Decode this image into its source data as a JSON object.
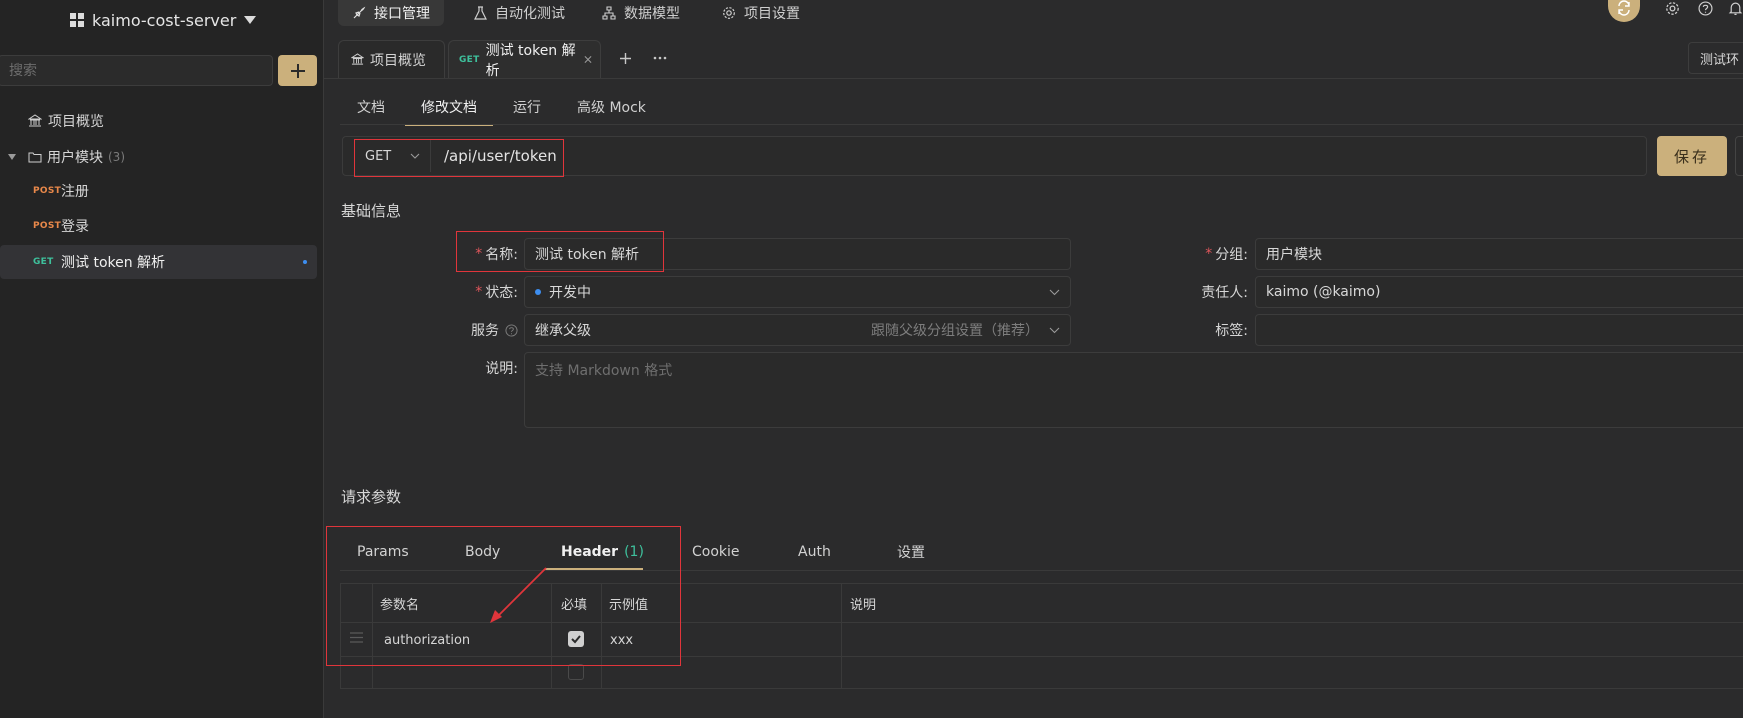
{
  "sidebar": {
    "project_name": "kaimo-cost-server",
    "search_placeholder": "搜索",
    "overview_label": "项目概览",
    "folder": {
      "label": "用户模块",
      "count": "(3)"
    },
    "items": [
      {
        "method": "POST",
        "label": "注册"
      },
      {
        "method": "POST",
        "label": "登录"
      },
      {
        "method": "GET",
        "label": "测试 token 解析"
      }
    ]
  },
  "topnav": {
    "items": [
      "接口管理",
      "自动化测试",
      "数据模型",
      "项目设置"
    ],
    "active_index": 0
  },
  "doc_tabs": {
    "overview": "项目概览",
    "active_method": "GET",
    "active_label": "测试 token 解析",
    "env_label": "测试环"
  },
  "sub_tabs": [
    "文档",
    "修改文档",
    "运行",
    "高级 Mock"
  ],
  "sub_tabs_active": 1,
  "request": {
    "method": "GET",
    "path": "/api/user/token",
    "save_label": "保存"
  },
  "basic_info": {
    "title": "基础信息",
    "name_label": "名称:",
    "name_value": "测试 token 解析",
    "status_label": "状态:",
    "status_value": "开发中",
    "service_label": "服务",
    "service_value": "继承父级",
    "service_hint": "跟随父级分组设置（推荐）",
    "desc_label": "说明:",
    "desc_placeholder": "支持 Markdown 格式",
    "group_label": "分组:",
    "group_value": "用户模块",
    "owner_label": "责任人:",
    "owner_value": "kaimo (@kaimo)",
    "tags_label": "标签:"
  },
  "request_params": {
    "title": "请求参数",
    "tabs": [
      "Params",
      "Body",
      "Header",
      "Cookie",
      "Auth",
      "设置"
    ],
    "header_count": "(1)",
    "active_index": 2,
    "columns": [
      "参数名",
      "必填",
      "示例值",
      "说明"
    ],
    "rows": [
      {
        "name": "authorization",
        "required": true,
        "example": "xxx",
        "desc": ""
      }
    ]
  },
  "colors": {
    "accent": "#cbb07c",
    "get": "#3ec09c",
    "post": "#e8884a",
    "highlight": "#e0353b"
  }
}
